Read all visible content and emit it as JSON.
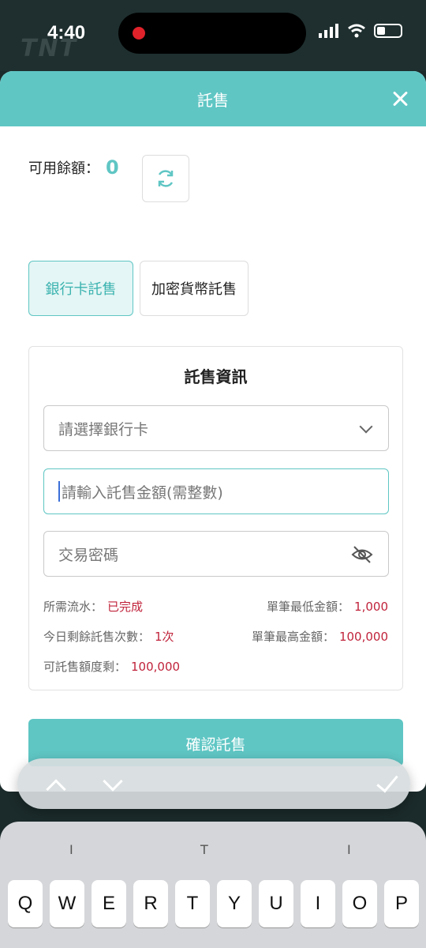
{
  "status_bar": {
    "time": "4:40"
  },
  "background": {
    "logo_text": "TNT"
  },
  "modal": {
    "title": "託售",
    "balance_label": "可用餘額：",
    "balance_value": "0",
    "tabs": [
      {
        "label": "銀行卡託售",
        "active": true
      },
      {
        "label": "加密貨幣託售",
        "active": false
      }
    ],
    "form": {
      "title": "託售資訊",
      "bank_select_placeholder": "請選擇銀行卡",
      "amount_placeholder": "請輸入託售金額(需整數)",
      "password_placeholder": "交易密碼"
    },
    "info": {
      "required_flow_label": "所需流水：",
      "required_flow_value": "已完成",
      "min_amount_label": "單筆最低金額：",
      "min_amount_value": "1,000",
      "remaining_count_label": "今日剩餘託售次數：",
      "remaining_count_value": "1次",
      "max_amount_label": "單筆最高金額：",
      "max_amount_value": "100,000",
      "quota_label": "可託售額度剩：",
      "quota_value": "100,000"
    },
    "confirm_label": "確認託售"
  },
  "keyboard": {
    "suggestions": [
      "I",
      "T",
      "I"
    ],
    "row1": [
      "Q",
      "W",
      "E",
      "R",
      "T",
      "Y",
      "U",
      "I",
      "O",
      "P"
    ]
  },
  "colors": {
    "accent": "#5fc6c4",
    "value_red": "#c0233b"
  }
}
